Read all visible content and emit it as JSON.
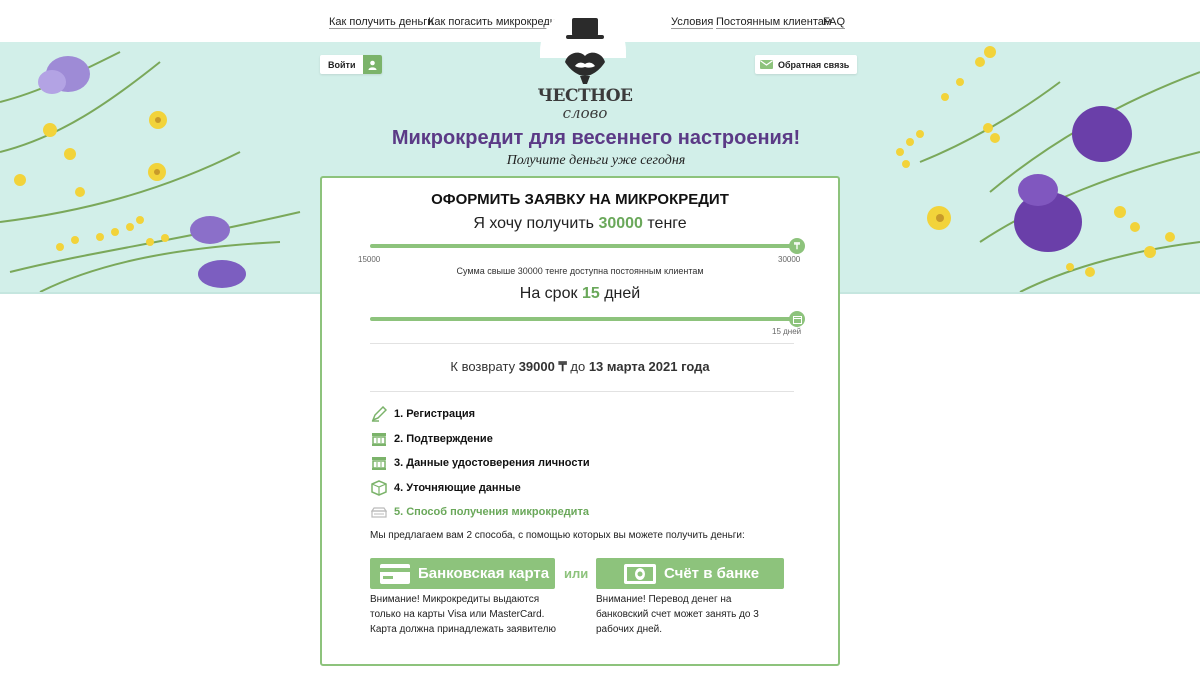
{
  "nav": {
    "left": [
      "Как получить деньги",
      "Как погасить микрокредит"
    ],
    "right": [
      "Условия",
      "Постоянным клиентам",
      "FAQ"
    ]
  },
  "header": {
    "login_label": "Войти",
    "feedback_label": "Обратная связь",
    "logo_line1": "ЧЕСТНОЕ",
    "logo_line2": "слово",
    "headline": "Микрокредит для весеннего настроения!",
    "subline": "Получите деньги уже сегодня"
  },
  "form": {
    "title": "ОФОРМИТЬ ЗАЯВКУ НА МИКРОКРЕДИТ",
    "amount_prefix": "Я хочу получить",
    "amount_value": "30000",
    "amount_suffix": "тенге",
    "amount_min": "15000",
    "amount_max": "30000",
    "amount_slider_fraction": 1.0,
    "amount_note": "Сумма свыше 30000 тенге доступна постоянным клиентам",
    "term_prefix": "На срок",
    "term_value": "15",
    "term_suffix": "дней",
    "term_tick": "15 дней",
    "term_slider_fraction": 1.0,
    "return_prefix": "К возврату",
    "return_amount": "39000 ₸",
    "return_mid": "до",
    "return_date": "13 марта 2021 года",
    "steps": [
      {
        "label": "1. Регистрация",
        "icon": "pen-icon"
      },
      {
        "label": "2. Подтверждение",
        "icon": "building-icon"
      },
      {
        "label": "3. Данные удостоверения личности",
        "icon": "building-icon"
      },
      {
        "label": "4. Уточняющие данные",
        "icon": "box-icon"
      },
      {
        "label": "5. Способ получения микрокредита",
        "icon": "cash-icon"
      }
    ],
    "offer_text": "Мы предлагаем вам 2 способа, с помощью которых вы можете получить деньги:",
    "card_btn": "Банковская карта",
    "or_label": "или",
    "bank_btn": "Счёт в банке",
    "card_warning": [
      "Внимание! Микрокредиты выдаются",
      "только на карты Visa или MasterCard.",
      "Карта должна принадлежать заявителю"
    ],
    "bank_warning": [
      "Внимание! Перевод денег на",
      "банковский счет может занять до 3",
      "рабочих дней."
    ]
  },
  "colors": {
    "accent": "#8dc37c",
    "headline": "#5b3a86",
    "banner_bg": "#d2efe9"
  }
}
